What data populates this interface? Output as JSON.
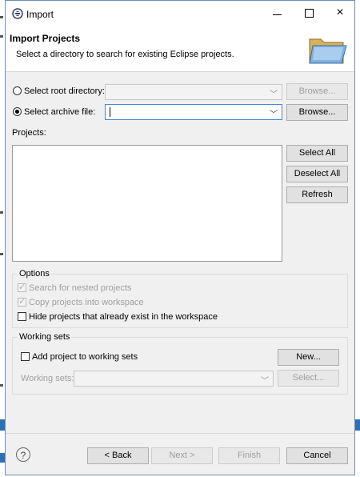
{
  "window": {
    "title": "Import"
  },
  "header": {
    "title": "Import Projects",
    "description": "Select a directory to search for existing Eclipse projects."
  },
  "source": {
    "root_dir_label": "Select root directory:",
    "root_dir_value": "",
    "root_dir_selected": false,
    "archive_label": "Select archive file:",
    "archive_value": "",
    "archive_selected": true,
    "browse_label": "Browse..."
  },
  "projects": {
    "label": "Projects:",
    "items": [],
    "select_all": "Select All",
    "deselect_all": "Deselect All",
    "refresh": "Refresh"
  },
  "options": {
    "label": "Options",
    "search_nested": "Search for nested projects",
    "copy_projects": "Copy projects into workspace",
    "hide_existing": "Hide projects that already exist in the workspace"
  },
  "working_sets": {
    "label": "Working sets",
    "add_label": "Add project to working sets",
    "new_label": "New...",
    "sets_label": "Working sets:",
    "select_label": "Select..."
  },
  "footer": {
    "back": "< Back",
    "next": "Next >",
    "finish": "Finish",
    "cancel": "Cancel"
  },
  "colors": {
    "accent": "#4a86d8",
    "dialog_bg": "#f0f0f0",
    "button_bg": "#e1e1e1"
  }
}
